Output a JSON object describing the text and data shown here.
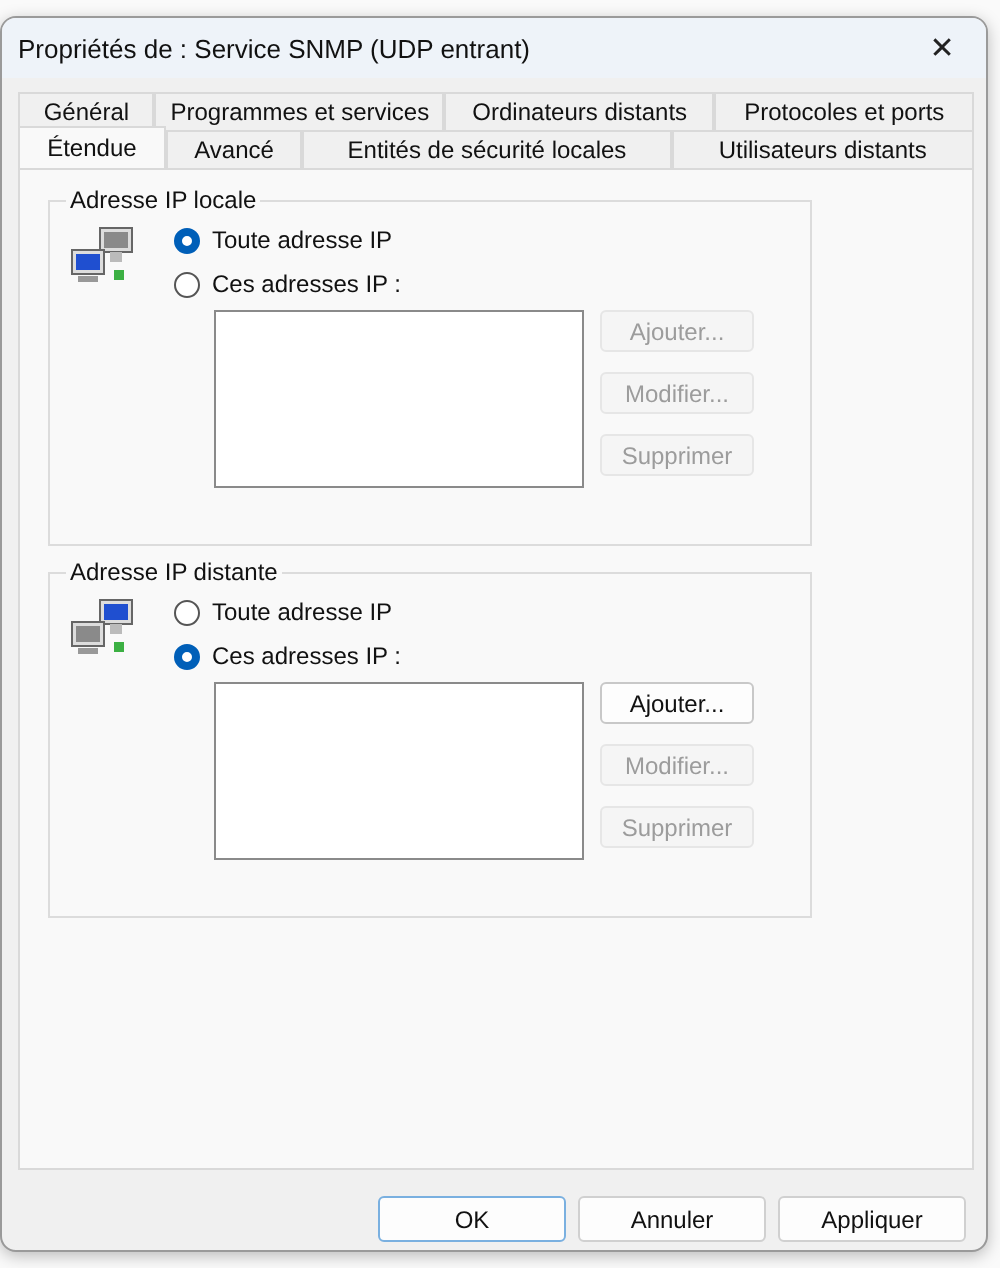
{
  "window": {
    "title": "Propriétés de : Service SNMP (UDP entrant)",
    "close": "✕"
  },
  "tab_rows": [
    [
      {
        "label": "Général",
        "selected": false
      },
      {
        "label": "Programmes et services",
        "selected": false
      },
      {
        "label": "Ordinateurs distants",
        "selected": false
      },
      {
        "label": "Protocoles et ports",
        "selected": false
      }
    ],
    [
      {
        "label": "Étendue",
        "selected": true
      },
      {
        "label": "Avancé",
        "selected": false
      },
      {
        "label": "Entités de sécurité locales",
        "selected": false
      },
      {
        "label": "Utilisateurs distants",
        "selected": false
      }
    ]
  ],
  "groups": [
    {
      "title": "Adresse IP locale",
      "kind": "local",
      "options": [
        {
          "label": "Toute adresse IP",
          "selected": true
        },
        {
          "label": "Ces adresses IP :",
          "selected": false
        }
      ],
      "buttons": [
        {
          "label": "Ajouter...",
          "disabled": true
        },
        {
          "label": "Modifier...",
          "disabled": true
        },
        {
          "label": "Supprimer",
          "disabled": true
        }
      ]
    },
    {
      "title": "Adresse IP distante",
      "kind": "remote",
      "options": [
        {
          "label": "Toute adresse IP",
          "selected": false
        },
        {
          "label": "Ces adresses IP :",
          "selected": true
        }
      ],
      "buttons": [
        {
          "label": "Ajouter...",
          "disabled": false
        },
        {
          "label": "Modifier...",
          "disabled": true
        },
        {
          "label": "Supprimer",
          "disabled": true
        }
      ]
    }
  ],
  "buttons": [
    {
      "label": "OK",
      "default": true
    },
    {
      "label": "Annuler",
      "default": false
    },
    {
      "label": "Appliquer",
      "default": false
    }
  ]
}
